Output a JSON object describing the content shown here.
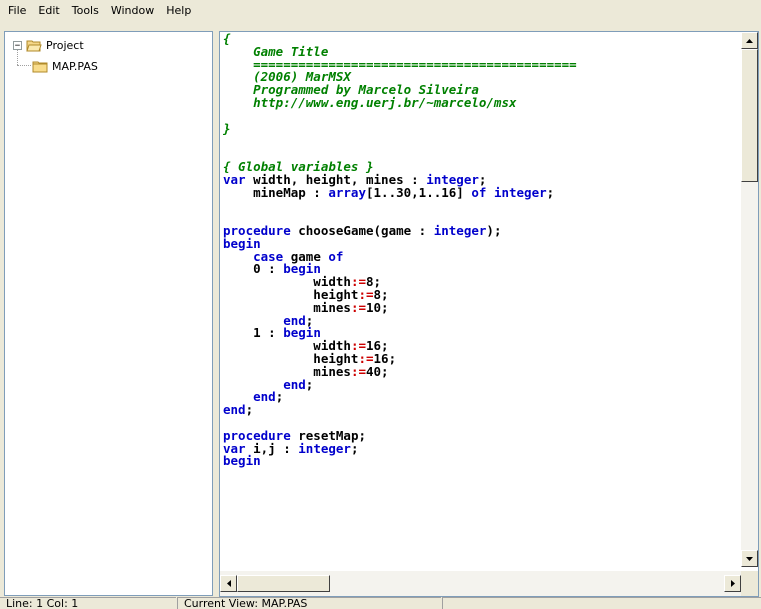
{
  "menu": {
    "items": [
      "File",
      "Edit",
      "Tools",
      "Window",
      "Help"
    ]
  },
  "project_tree": {
    "root": {
      "label": "Project",
      "expander": "−",
      "icon": "open-folder-icon"
    },
    "children": [
      {
        "label": "MAP.PAS",
        "icon": "folder-icon"
      }
    ]
  },
  "editor": {
    "lines": [
      [
        [
          "comment",
          "{"
        ]
      ],
      [
        [
          "comment",
          "    Game Title"
        ]
      ],
      [
        [
          "comment",
          "    ==========================================="
        ]
      ],
      [
        [
          "comment",
          "    (2006) MarMSX"
        ]
      ],
      [
        [
          "comment",
          "    Programmed by Marcelo Silveira"
        ]
      ],
      [
        [
          "comment",
          "    http://www.eng.uerj.br/~marcelo/msx"
        ]
      ],
      [
        [
          "plain",
          ""
        ]
      ],
      [
        [
          "comment",
          "}"
        ]
      ],
      [
        [
          "plain",
          ""
        ]
      ],
      [
        [
          "plain",
          ""
        ]
      ],
      [
        [
          "comment",
          "{ Global variables }"
        ]
      ],
      [
        [
          "kw",
          "var"
        ],
        [
          "plain",
          " width, height, mines : "
        ],
        [
          "kw",
          "integer"
        ],
        [
          "plain",
          ";"
        ]
      ],
      [
        [
          "plain",
          "    mineMap : "
        ],
        [
          "kw",
          "array"
        ],
        [
          "plain",
          "[1..30,1..16] "
        ],
        [
          "kw",
          "of"
        ],
        [
          "plain",
          " "
        ],
        [
          "kw",
          "integer"
        ],
        [
          "plain",
          ";"
        ]
      ],
      [
        [
          "plain",
          ""
        ]
      ],
      [
        [
          "plain",
          ""
        ]
      ],
      [
        [
          "kw",
          "procedure"
        ],
        [
          "plain",
          " chooseGame(game : "
        ],
        [
          "kw",
          "integer"
        ],
        [
          "plain",
          ");"
        ]
      ],
      [
        [
          "kw",
          "begin"
        ]
      ],
      [
        [
          "plain",
          "    "
        ],
        [
          "kw",
          "case"
        ],
        [
          "plain",
          " game "
        ],
        [
          "kw",
          "of"
        ]
      ],
      [
        [
          "plain",
          "    0 : "
        ],
        [
          "kw",
          "begin"
        ]
      ],
      [
        [
          "plain",
          "            width"
        ],
        [
          "op",
          ":="
        ],
        [
          "plain",
          "8;"
        ]
      ],
      [
        [
          "plain",
          "            height"
        ],
        [
          "op",
          ":="
        ],
        [
          "plain",
          "8;"
        ]
      ],
      [
        [
          "plain",
          "            mines"
        ],
        [
          "op",
          ":="
        ],
        [
          "plain",
          "10;"
        ]
      ],
      [
        [
          "plain",
          "        "
        ],
        [
          "kw",
          "end"
        ],
        [
          "plain",
          ";"
        ]
      ],
      [
        [
          "plain",
          "    1 : "
        ],
        [
          "kw",
          "begin"
        ]
      ],
      [
        [
          "plain",
          "            width"
        ],
        [
          "op",
          ":="
        ],
        [
          "plain",
          "16;"
        ]
      ],
      [
        [
          "plain",
          "            height"
        ],
        [
          "op",
          ":="
        ],
        [
          "plain",
          "16;"
        ]
      ],
      [
        [
          "plain",
          "            mines"
        ],
        [
          "op",
          ":="
        ],
        [
          "plain",
          "40;"
        ]
      ],
      [
        [
          "plain",
          "        "
        ],
        [
          "kw",
          "end"
        ],
        [
          "plain",
          ";"
        ]
      ],
      [
        [
          "plain",
          "    "
        ],
        [
          "kw",
          "end"
        ],
        [
          "plain",
          ";"
        ]
      ],
      [
        [
          "kw",
          "end"
        ],
        [
          "plain",
          ";"
        ]
      ],
      [
        [
          "plain",
          ""
        ]
      ],
      [
        [
          "kw",
          "procedure"
        ],
        [
          "plain",
          " resetMap;"
        ]
      ],
      [
        [
          "kw",
          "var"
        ],
        [
          "plain",
          " i,j : "
        ],
        [
          "kw",
          "integer"
        ],
        [
          "plain",
          ";"
        ]
      ],
      [
        [
          "kw",
          "begin"
        ]
      ]
    ]
  },
  "status": {
    "position": "Line: 1 Col: 1",
    "view": "Current View: MAP.PAS",
    "extra": ""
  },
  "colors": {
    "comment": "#008000",
    "keyword": "#0000cc",
    "operator": "#cc0000"
  }
}
